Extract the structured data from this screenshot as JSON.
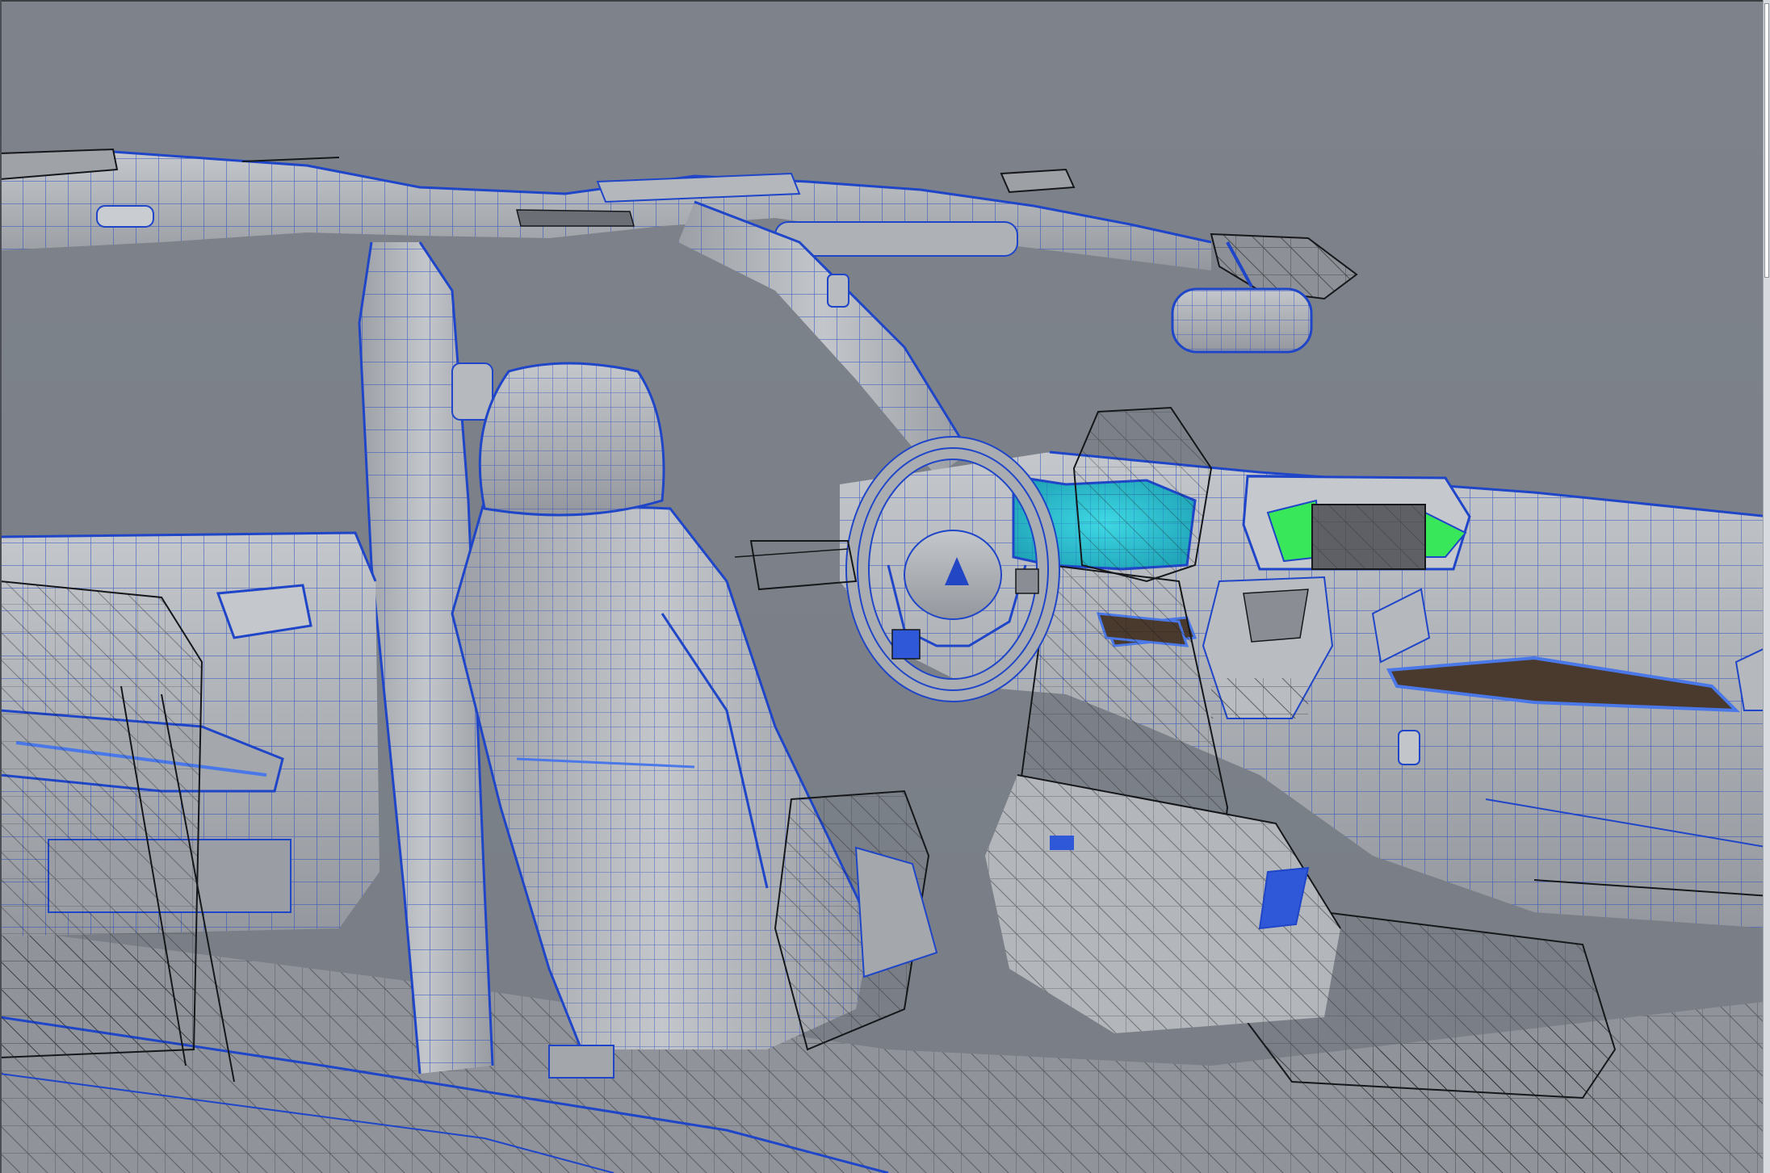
{
  "viewport": {
    "label": "",
    "background": "#7b8087"
  },
  "colors": {
    "surface": "#a6aab0",
    "surface_light": "#c7cacd",
    "surface_dark": "#8f949a",
    "wire_blue": "#1f45c8",
    "wire_black": "#15171a",
    "cluster_cyan": "#2fc6d4",
    "display_green": "#39e85a",
    "display_screen": "#5e6065",
    "trim_brown": "#4a3a2e",
    "highlight_blue": "#4a78e8"
  },
  "parts": [
    {
      "name": "headliner",
      "icon": "headliner-panel"
    },
    {
      "name": "b-pillar",
      "icon": "pillar"
    },
    {
      "name": "a-pillar",
      "icon": "pillar"
    },
    {
      "name": "rear-view-mirror",
      "icon": "mirror"
    },
    {
      "name": "sun-visor",
      "icon": "visor"
    },
    {
      "name": "rear-door-panel",
      "icon": "door-panel"
    },
    {
      "name": "driver-seat",
      "icon": "seat"
    },
    {
      "name": "headrest",
      "icon": "headrest"
    },
    {
      "name": "steering-wheel",
      "icon": "steering-wheel"
    },
    {
      "name": "instrument-cluster",
      "icon": "gauge-cluster"
    },
    {
      "name": "center-display",
      "icon": "display-screen"
    },
    {
      "name": "dashboard",
      "icon": "dashboard"
    },
    {
      "name": "center-console",
      "icon": "console"
    },
    {
      "name": "wireframe-seat",
      "icon": "seat-wireframe"
    },
    {
      "name": "floor",
      "icon": "floor-panel"
    }
  ],
  "scrollbar": {
    "orientation": "vertical",
    "position": 0
  }
}
